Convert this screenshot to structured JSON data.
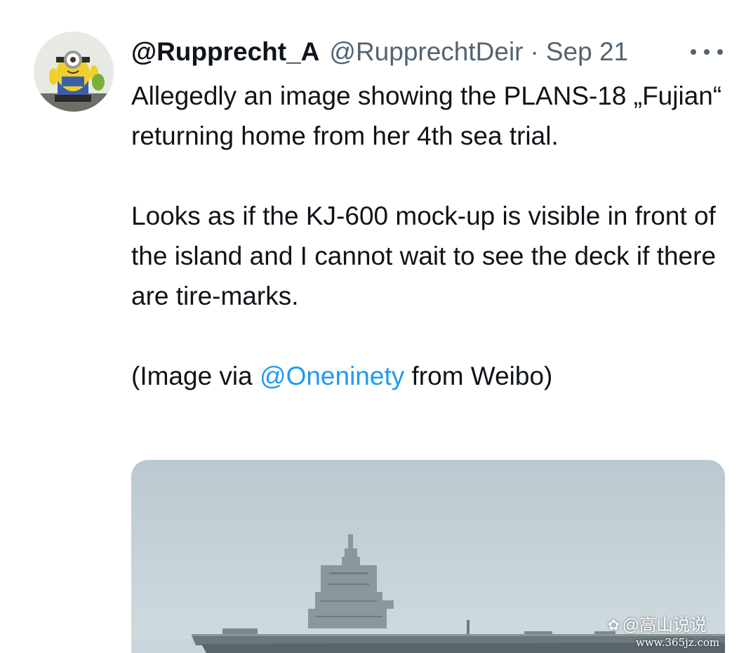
{
  "tweet": {
    "display_name": "@Rupprecht_A",
    "handle": "@RupprechtDeir",
    "separator": "·",
    "date": "Sep 21",
    "more_label": "More",
    "paragraph1": "Allegedly an image showing the PLANS-18 „Fujian“ returning home from her 4th sea trial.",
    "paragraph2": "Looks as if the KJ-600 mock-up is visible in front of the island and I cannot wait to see the deck if there are tire-marks.",
    "paragraph3_prefix": "(Image via ",
    "paragraph3_mention": "@Oneninety",
    "paragraph3_suffix": " from Weibo)",
    "media_alt": "Aircraft carrier at sea"
  },
  "watermark": {
    "icon": "weibo-icon",
    "line1": "@高山说说",
    "line2": "www.365jz.com"
  },
  "colors": {
    "text": "#0f1419",
    "secondary": "#536471",
    "link": "#1d9bf0"
  }
}
